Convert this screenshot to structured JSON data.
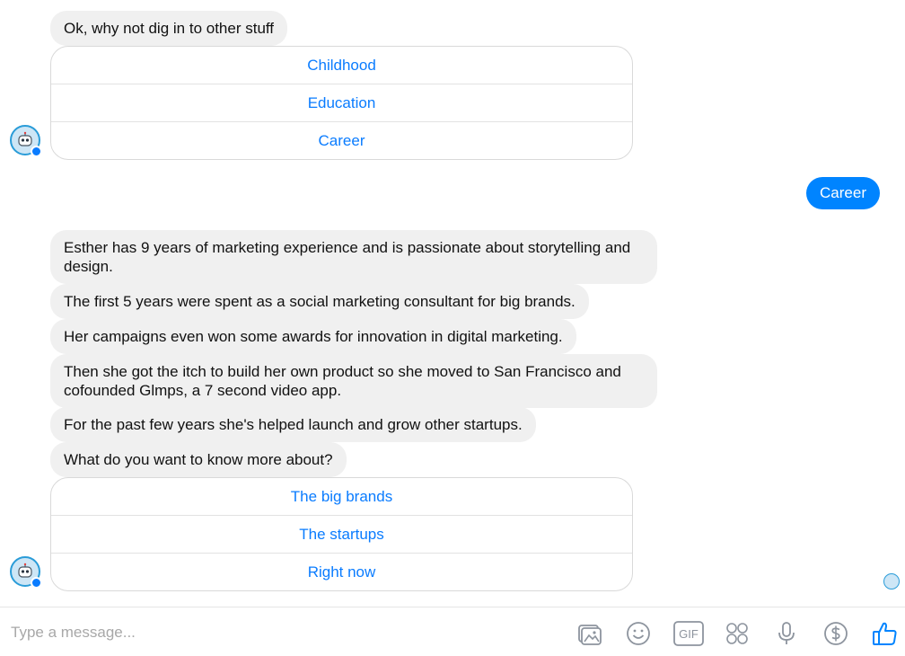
{
  "chat": {
    "first_prompt": "Ok, why not dig in to other stuff",
    "first_replies": [
      "Childhood",
      "Education",
      "Career"
    ],
    "user_message": "Career",
    "messages": [
      "Esther has 9 years of marketing experience and is passionate about storytelling and design.",
      "The first 5 years were spent as a social marketing consultant for big brands.",
      "Her campaigns even won some awards for innovation in digital marketing.",
      "Then she got the itch to build her own product so she moved to San Francisco and cofounded Glmps, a 7 second video app.",
      "For the past few years she's helped launch and grow other startups.",
      "What do you want to know more about?"
    ],
    "second_replies": [
      "The big brands",
      "The startups",
      "Right now"
    ]
  },
  "composer": {
    "placeholder": "Type a message...",
    "gif_label": "GIF",
    "icons": [
      "photo-icon",
      "emoji-icon",
      "gif-icon",
      "stickers-icon",
      "microphone-icon",
      "payment-icon",
      "like-icon"
    ]
  },
  "colors": {
    "accent": "#0084ff",
    "reply_text": "#0a7cff",
    "bot_bubble": "#f0f0f0",
    "icon_gray": "#8d949e"
  }
}
